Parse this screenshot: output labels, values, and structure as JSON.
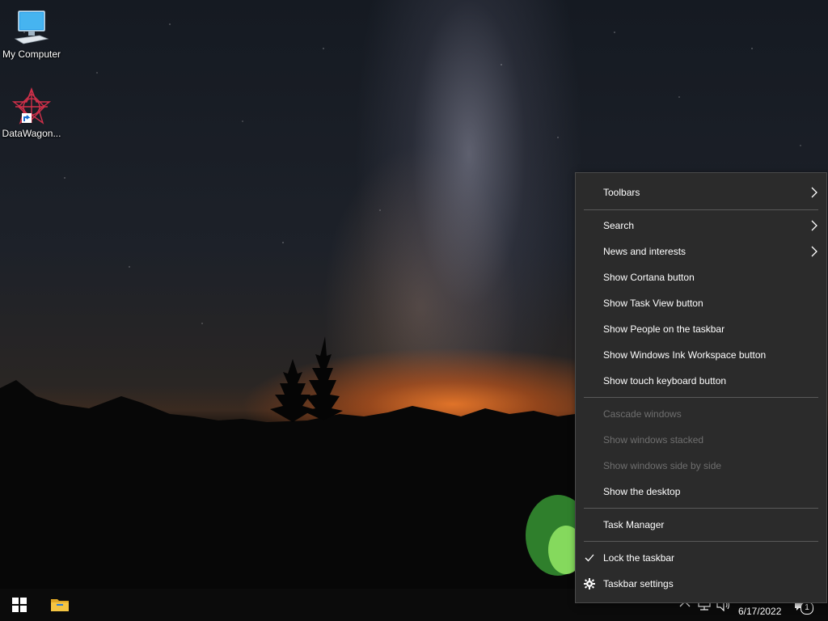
{
  "desktop": {
    "icons": [
      {
        "label": "My Computer",
        "icon": "monitor-icon"
      },
      {
        "label": "DataWagon...",
        "icon": "datawagon-app-icon"
      }
    ]
  },
  "context_menu": {
    "items": [
      {
        "label": "Toolbars",
        "submenu": true
      },
      {
        "label": "Search",
        "submenu": true
      },
      {
        "label": "News and interests",
        "submenu": true
      },
      {
        "label": "Show Cortana button"
      },
      {
        "label": "Show Task View button"
      },
      {
        "label": "Show People on the taskbar"
      },
      {
        "label": "Show Windows Ink Workspace button"
      },
      {
        "label": "Show touch keyboard button"
      },
      {
        "label": "Cascade windows",
        "disabled": true
      },
      {
        "label": "Show windows stacked",
        "disabled": true
      },
      {
        "label": "Show windows side by side",
        "disabled": true
      },
      {
        "label": "Show the desktop"
      },
      {
        "label": "Task Manager"
      },
      {
        "label": "Lock the taskbar",
        "checked": true
      },
      {
        "label": "Taskbar settings",
        "icon": "gear-icon"
      }
    ]
  },
  "taskbar": {
    "date": "6/17/2022",
    "notification_count": "1",
    "icons": [
      "windows-start-icon",
      "file-explorer-icon",
      "chevron-up-icon",
      "network-icon",
      "volume-icon",
      "notification-icon"
    ]
  },
  "colors": {
    "menu_bg": "#2b2b2b",
    "menu_text": "#ffffff",
    "menu_disabled": "#6f6f6f",
    "taskbar_bg": "#0b0b0b",
    "start_blue": "#ffffff",
    "explorer_yellow": "#f4c542"
  }
}
